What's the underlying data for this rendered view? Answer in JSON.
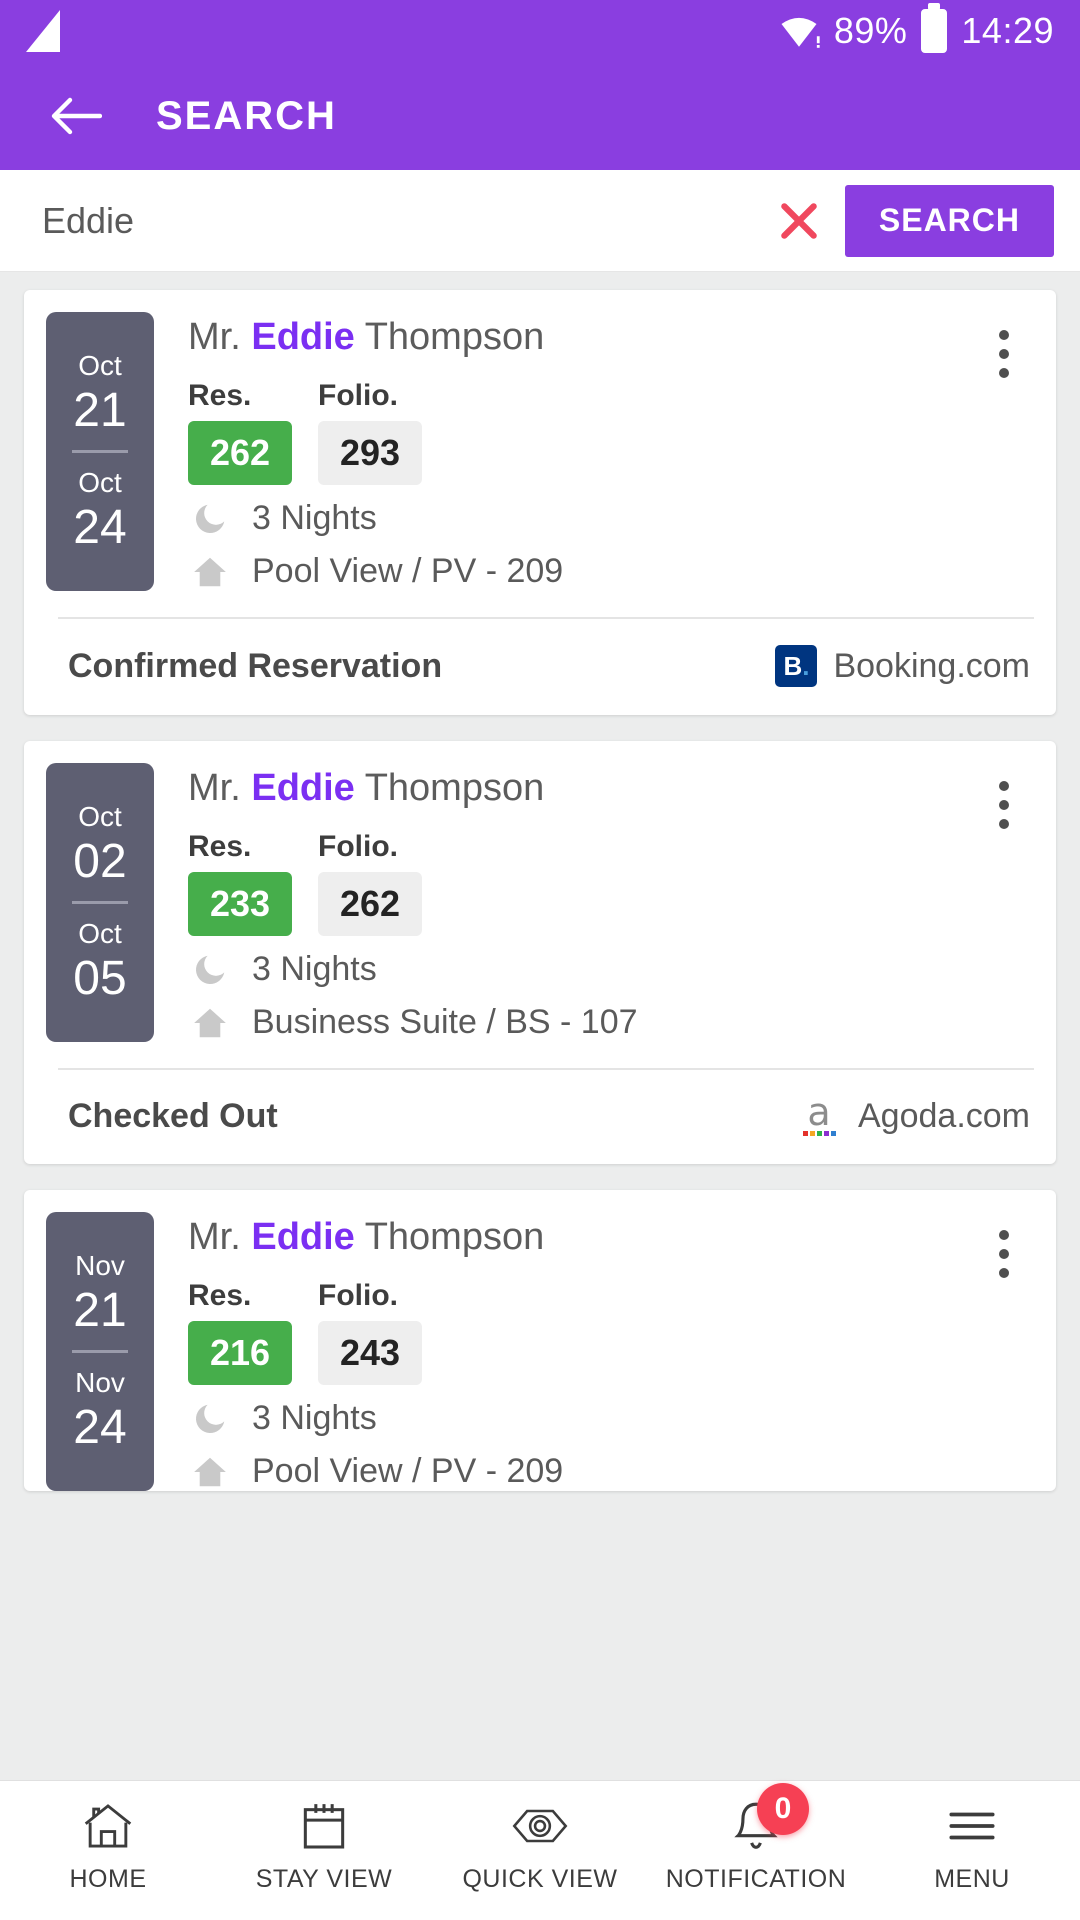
{
  "status_bar": {
    "signal_icon": "signal-triangle-icon",
    "wifi_icon": "wifi-icon",
    "battery_percent": "89%",
    "battery_icon": "battery-icon",
    "time": "14:29"
  },
  "app_bar": {
    "back_icon": "back-arrow-icon",
    "title": "SEARCH"
  },
  "search": {
    "value": "Eddie",
    "placeholder": "Search",
    "clear_icon": "close-x-icon",
    "button_label": "SEARCH",
    "accent_color": "#8a3ee0",
    "clear_color": "#f0485e"
  },
  "labels": {
    "res": "Res.",
    "folio": "Folio.",
    "nights_icon": "moon-icon",
    "room_icon": "home-icon",
    "kebab_icon": "more-vertical-icon"
  },
  "reservations": [
    {
      "check_in_month": "Oct",
      "check_in_day": "21",
      "check_out_month": "Oct",
      "check_out_day": "24",
      "title_prefix": "Mr.",
      "name_highlight": "Eddie",
      "title_suffix": "Thompson",
      "res_no": "262",
      "folio_no": "293",
      "nights": "3 Nights",
      "room": "Pool View / PV - 209",
      "status": "Confirmed Reservation",
      "source": "Booking.com",
      "source_logo": "booking-logo"
    },
    {
      "check_in_month": "Oct",
      "check_in_day": "02",
      "check_out_month": "Oct",
      "check_out_day": "05",
      "title_prefix": "Mr.",
      "name_highlight": "Eddie",
      "title_suffix": "Thompson",
      "res_no": "233",
      "folio_no": "262",
      "nights": "3 Nights",
      "room": "Business Suite / BS - 107",
      "status": "Checked Out",
      "source": "Agoda.com",
      "source_logo": "agoda-logo"
    },
    {
      "check_in_month": "Nov",
      "check_in_day": "21",
      "check_out_month": "Nov",
      "check_out_day": "24",
      "title_prefix": "Mr.",
      "name_highlight": "Eddie",
      "title_suffix": "Thompson",
      "res_no": "216",
      "folio_no": "243",
      "nights": "3 Nights",
      "room": "Pool View / PV - 209",
      "status": "",
      "source": "",
      "source_logo": ""
    }
  ],
  "bottom_nav": [
    {
      "label": "HOME",
      "icon": "home-icon"
    },
    {
      "label": "STAY VIEW",
      "icon": "calendar-icon"
    },
    {
      "label": "QUICK VIEW",
      "icon": "eye-icon"
    },
    {
      "label": "NOTIFICATION",
      "icon": "bell-icon",
      "badge": "0"
    },
    {
      "label": "MENU",
      "icon": "hamburger-menu-icon"
    }
  ],
  "colors": {
    "brand_purple": "#8a3ee0",
    "name_highlight": "#7b2ff2",
    "res_green": "#46ae4b",
    "date_block": "#5e5f72",
    "badge_red": "#f64054",
    "booking_blue": "#003580"
  }
}
